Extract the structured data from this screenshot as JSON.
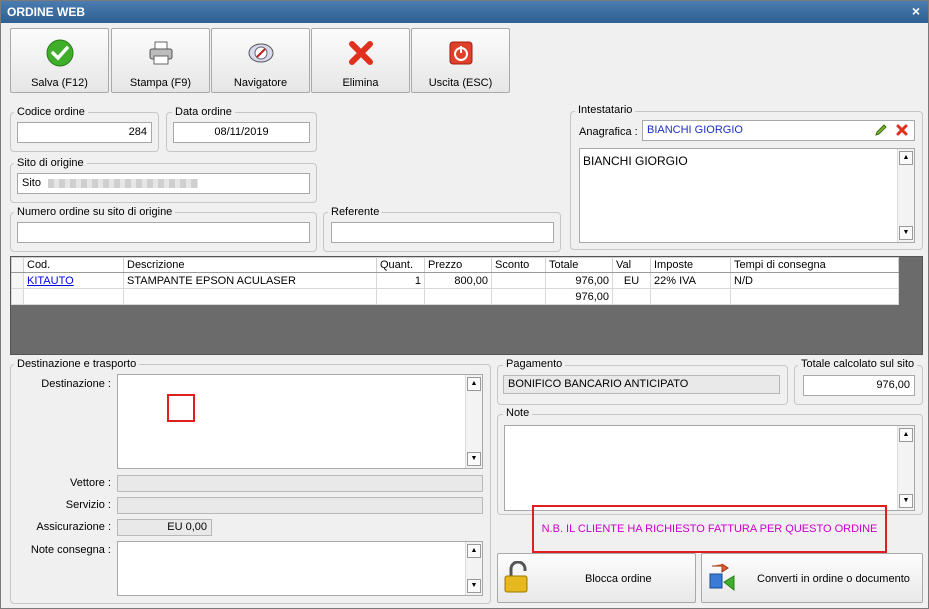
{
  "window": {
    "title": "ORDINE WEB",
    "close_glyph": "×"
  },
  "toolbar": {
    "save_label": "Salva (F12)",
    "print_label": "Stampa (F9)",
    "navigator_label": "Navigatore",
    "delete_label": "Elimina",
    "exit_label": "Uscita (ESC)"
  },
  "order": {
    "code_label": "Codice ordine",
    "code": "284",
    "date_label": "Data ordine",
    "date": "08/11/2019",
    "origin_site_label": "Sito di origine",
    "origin_site": "Sito",
    "origin_number_label": "Numero ordine su sito di origine",
    "origin_number": "",
    "referent_label": "Referente",
    "referent": ""
  },
  "holder": {
    "group_label": "Intestatario",
    "anagrafica_label": "Anagrafica :",
    "anagrafica": "BIANCHI GIORGIO",
    "memo": "BIANCHI GIORGIO"
  },
  "grid": {
    "columns": [
      "Cod.",
      "Descrizione",
      "Quant.",
      "Prezzo",
      "Sconto",
      "Totale",
      "Val",
      "Imposte",
      "Tempi di consegna"
    ],
    "rows": [
      {
        "code": "KITAUTO",
        "description": "STAMPANTE EPSON ACULASER",
        "qty": "1",
        "price": "800,00",
        "discount": "",
        "total": "976,00",
        "currency": "EU",
        "tax": "22% IVA",
        "delivery": "N/D"
      }
    ],
    "footer_total": "976,00"
  },
  "shipping": {
    "group_label": "Destinazione e trasporto",
    "destination_label": "Destinazione :",
    "destination": "",
    "carrier_label": "Vettore :",
    "carrier": "",
    "service_label": "Servizio :",
    "service": "",
    "insurance_label": "Assicurazione :",
    "insurance": "EU 0,00",
    "notes_label": "Note consegna :",
    "notes": ""
  },
  "payment": {
    "label": "Pagamento",
    "value": "BONIFICO BANCARIO ANTICIPATO"
  },
  "site_total": {
    "label": "Totale calcolato sul sito",
    "value": "976,00"
  },
  "notes": {
    "label": "Note",
    "value": ""
  },
  "invoice_notice": "N.B. IL CLIENTE HA RICHIESTO FATTURA PER QUESTO ORDINE",
  "actions": {
    "lock_label": "Blocca ordine",
    "convert_label": "Converti in ordine o documento"
  },
  "colors": {
    "title_bar": "#3a6ea5",
    "link": "#0000ee",
    "notice": "#cc00cc",
    "highlight": "#e02020",
    "grid_bg": "#6b6b6b"
  }
}
